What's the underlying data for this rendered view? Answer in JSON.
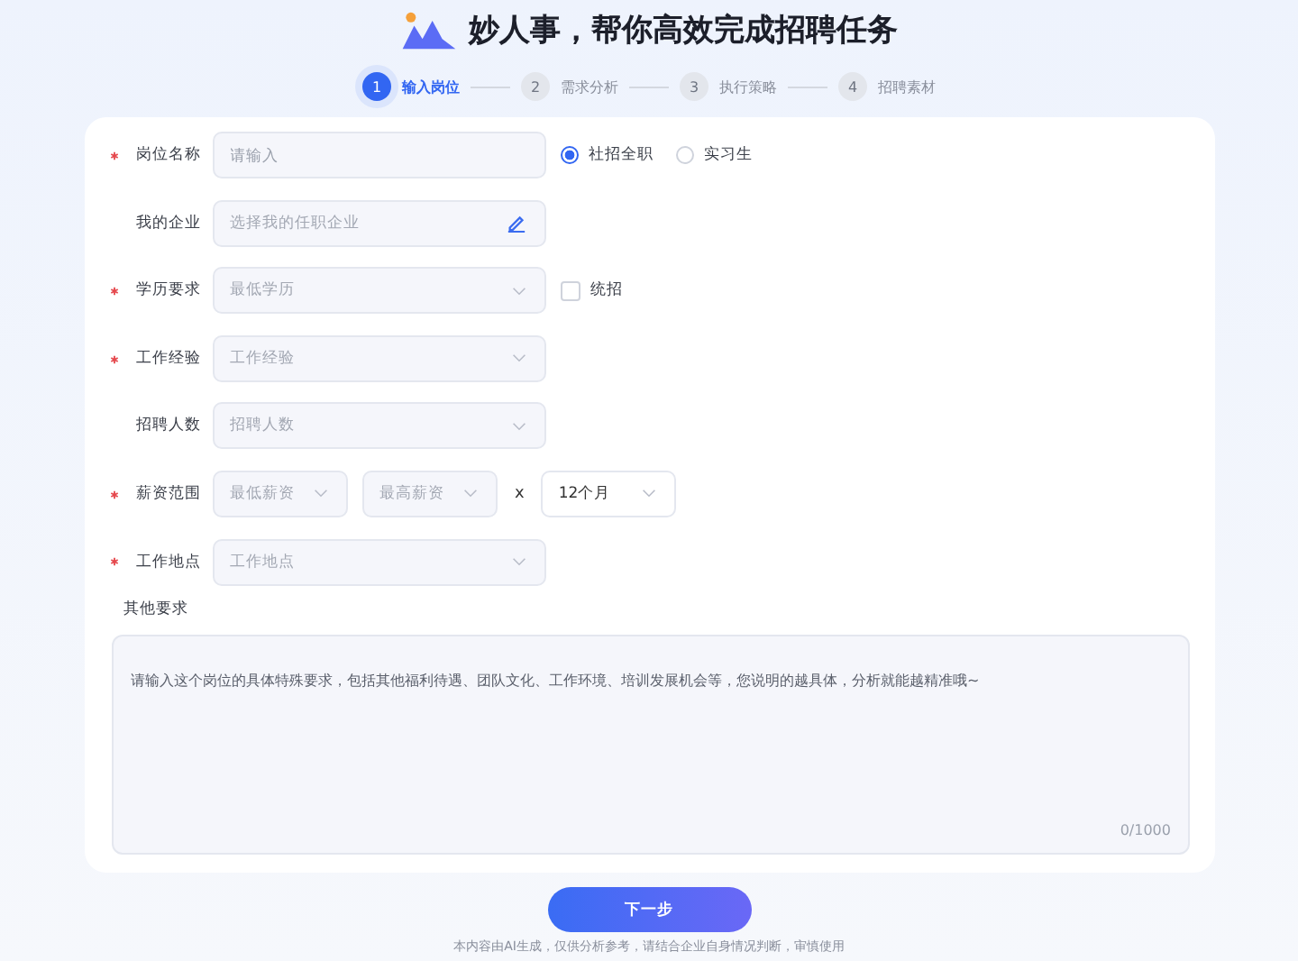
{
  "header": {
    "title": "妙人事，帮你高效完成招聘任务"
  },
  "steps": [
    {
      "number": "1",
      "label": "输入岗位",
      "selected": true
    },
    {
      "number": "2",
      "label": "需求分析",
      "selected": false
    },
    {
      "number": "3",
      "label": "执行策略",
      "selected": false
    },
    {
      "number": "4",
      "label": "招聘素材",
      "selected": false
    }
  ],
  "form": {
    "fields": [
      {
        "kind": "input",
        "label": "岗位名称",
        "required": true,
        "placeholder": "请输入",
        "radios": [
          {
            "label": "社招全职",
            "selected": true
          },
          {
            "label": "实习生",
            "selected": false
          }
        ]
      },
      {
        "kind": "picker",
        "label": "我的企业",
        "required": false,
        "placeholder": "选择我的任职企业"
      },
      {
        "kind": "select",
        "label": "学历要求",
        "required": true,
        "placeholder": "最低学历",
        "checkbox": {
          "label": "统招",
          "checked": false
        }
      },
      {
        "kind": "select",
        "label": "工作经验",
        "required": true,
        "placeholder": "工作经验"
      },
      {
        "kind": "select",
        "label": "招聘人数",
        "required": false,
        "placeholder": "招聘人数"
      },
      {
        "kind": "salary",
        "label": "薪资范围",
        "required": true,
        "min_placeholder": "最低薪资",
        "max_placeholder": "最高薪资",
        "times": "x",
        "months": "12个月"
      },
      {
        "kind": "select",
        "label": "工作地点",
        "required": true,
        "placeholder": "工作地点"
      }
    ],
    "other": {
      "label": "其他要求",
      "placeholder": "请输入这个岗位的具体特殊要求，包括其他福利待遇、团队文化、工作环境、培训发展机会等，您说明的越具体，分析就能越精准哦~",
      "counter": "0/1000"
    }
  },
  "next_button": "下一步",
  "disclaimer": "本内容由AI生成，仅供分析参考，请结合企业自身情况判断，审慎使用"
}
